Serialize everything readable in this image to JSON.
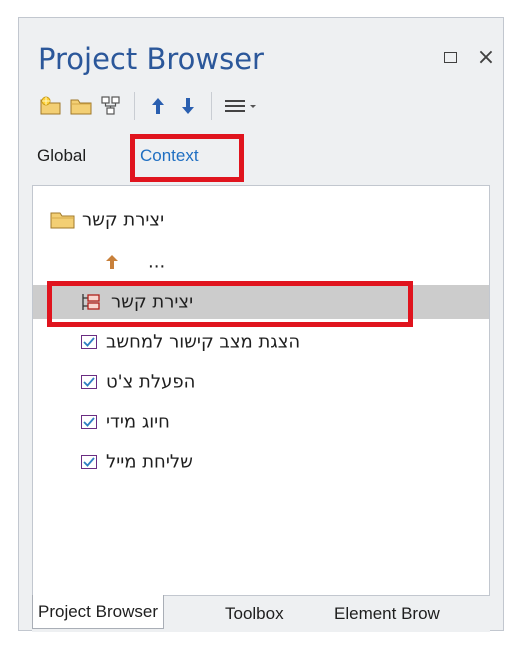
{
  "panel": {
    "title": "Project Browser",
    "restore_icon": "restore-window-icon",
    "close_glyph": "×"
  },
  "toolbar": {
    "buttons": [
      {
        "name": "new-model-button",
        "icon": "new-model-folder-icon"
      },
      {
        "name": "new-package-button",
        "icon": "folder-icon"
      },
      {
        "name": "new-diagram-button",
        "icon": "diagram-icon"
      },
      {
        "name": "move-up-button",
        "icon": "arrow-up-icon"
      },
      {
        "name": "move-down-button",
        "icon": "arrow-down-icon"
      },
      {
        "name": "menu-button",
        "icon": "hamburger-dropdown-icon"
      }
    ]
  },
  "scope_tabs": {
    "global": "Global",
    "context": "Context",
    "selected": "Context"
  },
  "tree": {
    "items": [
      {
        "label": "יצירת קשר",
        "icon": "folder-icon",
        "kind": "package"
      },
      {
        "label": "...",
        "icon": "arrow-up-icon",
        "kind": "parent"
      },
      {
        "label": "יצירת קשר",
        "icon": "use-case-diagram-icon",
        "kind": "diagram",
        "selected": true
      },
      {
        "label": "הצגת מצב קישור למחשב",
        "icon": "checklist-icon",
        "kind": "element"
      },
      {
        "label": "הפעלת צ'ט",
        "icon": "checklist-icon",
        "kind": "element"
      },
      {
        "label": "חיוג מידי",
        "icon": "checklist-icon",
        "kind": "element"
      },
      {
        "label": "שליחת מייל",
        "icon": "checklist-icon",
        "kind": "element"
      }
    ]
  },
  "bottom_tabs": {
    "items": [
      {
        "label": "Project Browser",
        "active": true
      },
      {
        "label": "Toolbox"
      },
      {
        "label": "Element Brow"
      }
    ]
  },
  "colors": {
    "title": "#2b579a",
    "context_tab": "#1f6fc2",
    "highlight": "#e0141e",
    "selected_row": "#cccccc",
    "folder": "#e8b64c",
    "arrow_up": "#c8803a",
    "arrow_blue": "#2a5fb0",
    "checklist_border": "#6b2d82",
    "check": "#2f7fc1"
  }
}
